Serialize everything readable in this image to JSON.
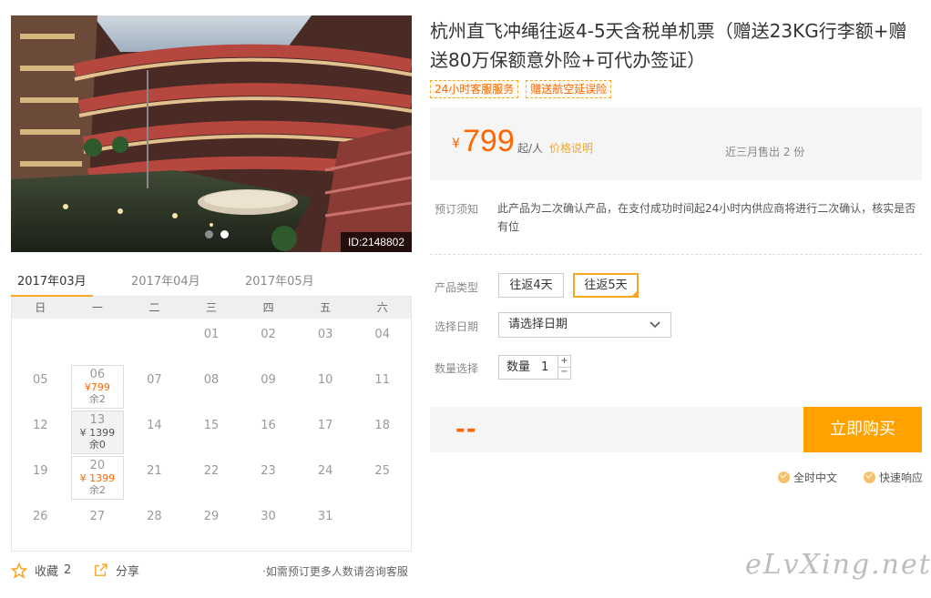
{
  "gallery": {
    "image_id": "ID:2148802",
    "slide_count": 2,
    "active_slide": 2
  },
  "calendar": {
    "tabs": [
      "2017年03月",
      "2017年04月",
      "2017年05月"
    ],
    "active_tab": 0,
    "weekdays": [
      "日",
      "一",
      "二",
      "三",
      "四",
      "五",
      "六"
    ],
    "rows": [
      [
        {
          "d": ""
        },
        {
          "d": ""
        },
        {
          "d": ""
        },
        {
          "d": "01"
        },
        {
          "d": "02"
        },
        {
          "d": "03"
        },
        {
          "d": "04"
        }
      ],
      [
        {
          "d": "05"
        },
        {
          "d": "06",
          "price": "¥799",
          "remain": "余2",
          "state": "avail"
        },
        {
          "d": "07"
        },
        {
          "d": "08"
        },
        {
          "d": "09"
        },
        {
          "d": "10"
        },
        {
          "d": "11"
        }
      ],
      [
        {
          "d": "12"
        },
        {
          "d": "13",
          "price": "¥ 1399",
          "remain": "余0",
          "state": "full"
        },
        {
          "d": "14"
        },
        {
          "d": "15"
        },
        {
          "d": "16"
        },
        {
          "d": "17"
        },
        {
          "d": "18"
        }
      ],
      [
        {
          "d": "19"
        },
        {
          "d": "20",
          "price": "¥ 1399",
          "remain": "余2",
          "state": "avail"
        },
        {
          "d": "21"
        },
        {
          "d": "22"
        },
        {
          "d": "23"
        },
        {
          "d": "24"
        },
        {
          "d": "25"
        }
      ],
      [
        {
          "d": "26"
        },
        {
          "d": "27"
        },
        {
          "d": "28"
        },
        {
          "d": "29"
        },
        {
          "d": "30"
        },
        {
          "d": "31"
        },
        {
          "d": ""
        }
      ]
    ]
  },
  "footer": {
    "favorite_label": "收藏",
    "favorite_count": "2",
    "share_label": "分享",
    "consult_tip": "如需预订更多人数请咨询客服",
    "watermark": "eLvXing.net"
  },
  "product": {
    "title": "杭州直飞冲绳往返4-5天含税单机票（赠送23KG行李额+赠送80万保额意外险+可代办签证）",
    "tags": [
      "24小时客服服务",
      "赠送航空延误险"
    ],
    "currency": "¥",
    "price": "799",
    "price_unit": "起/人",
    "price_note": "价格说明",
    "sold": "近三月售出 2 份",
    "notice_label": "预订须知",
    "notice_text": "此产品为二次确认产品，在支付成功时间起24小时内供应商将进行二次确认，核实是否有位",
    "type_label": "产品类型",
    "types": [
      "往返4天",
      "往返5天"
    ],
    "selected_type": 1,
    "date_label": "选择日期",
    "date_placeholder": "请选择日期",
    "qty_label": "数量选择",
    "qty_prefix": "数量",
    "qty_value": "1",
    "qty_plus": "+",
    "qty_minus": "−",
    "total": "--",
    "buy_label": "立即购买",
    "assurances": [
      "全时中文",
      "快速响应"
    ]
  },
  "colors": {
    "accent": "#ffa200",
    "price": "#ff6600"
  }
}
